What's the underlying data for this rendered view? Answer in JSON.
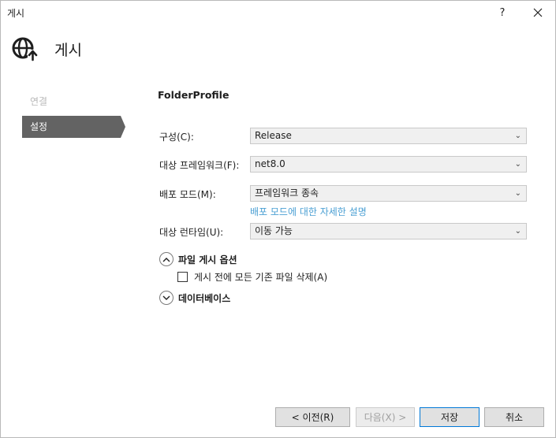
{
  "window": {
    "title": "게시",
    "help_label": "?",
    "close_label": "✕"
  },
  "header": {
    "title": "게시"
  },
  "nav": {
    "items": [
      {
        "label": "연결",
        "state": "disabled"
      },
      {
        "label": "설정",
        "state": "active"
      }
    ]
  },
  "profile": {
    "name": "FolderProfile"
  },
  "fields": {
    "configuration": {
      "label": "구성(C):",
      "value": "Release"
    },
    "target_framework": {
      "label": "대상 프레임워크(F):",
      "value": "net8.0"
    },
    "deployment_mode": {
      "label": "배포 모드(M):",
      "value": "프레임워크 종속",
      "help_link": "배포 모드에 대한 자세한 설명"
    },
    "target_runtime": {
      "label": "대상 런타임(U):",
      "value": "이동 가능"
    }
  },
  "sections": {
    "file_publish_options": {
      "title": "파일 게시 옵션",
      "expanded": true,
      "delete_existing": {
        "label": "게시 전에 모든 기존 파일 삭제(A)",
        "checked": false
      }
    },
    "databases": {
      "title": "데이터베이스",
      "expanded": false
    }
  },
  "footer": {
    "prev_label": "< 이전(R)",
    "next_label": "다음(X) >",
    "save_label": "저장",
    "cancel_label": "취소"
  },
  "colors": {
    "accent": "#0078d7",
    "link": "#4a9fd3",
    "nav_active": "#636363"
  }
}
